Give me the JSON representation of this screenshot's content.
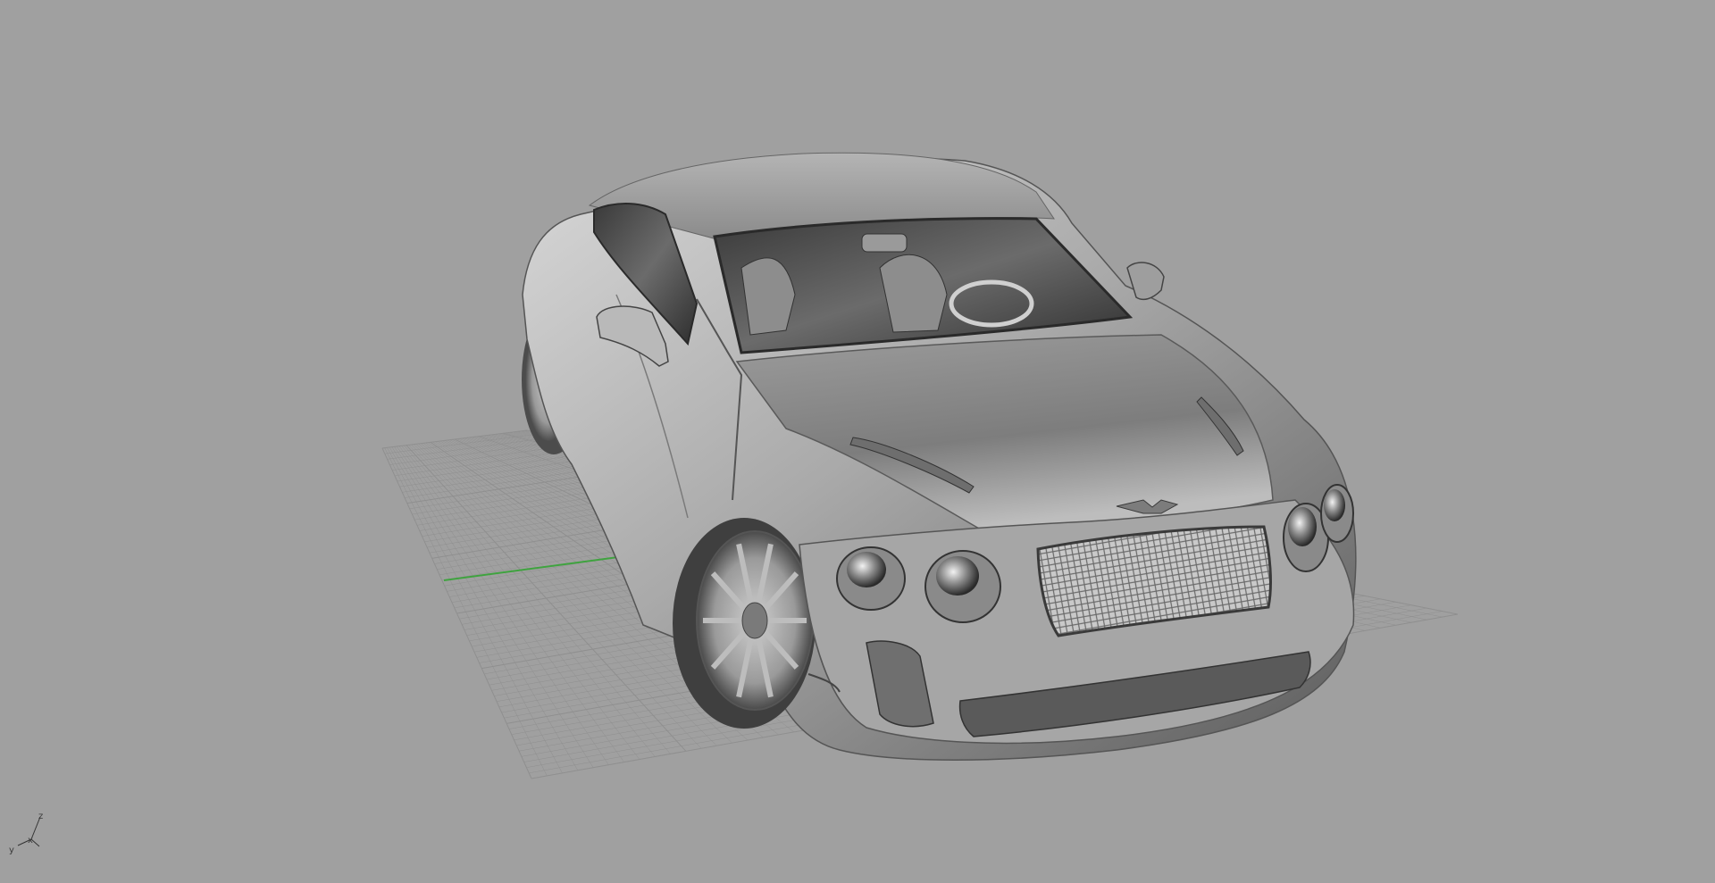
{
  "viewport": {
    "background_color": "#a0a0a0",
    "grid_color": "#8f8f8f",
    "x_axis_color": "#3fa33f",
    "object": "car-model-shaded"
  },
  "axis_widget": {
    "labels": {
      "z": "z",
      "x": "x",
      "y": "y"
    }
  }
}
